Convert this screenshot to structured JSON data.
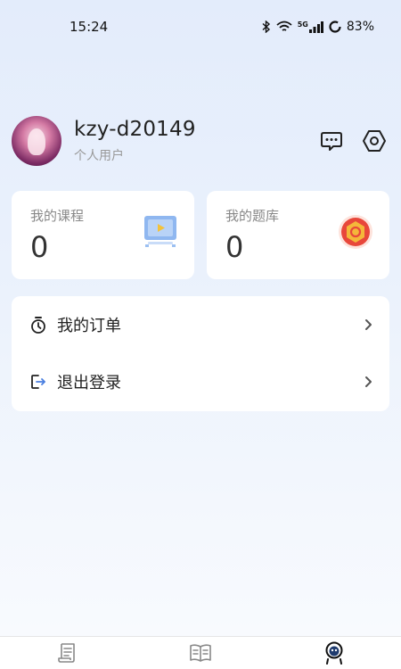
{
  "status_bar": {
    "time": "15:24",
    "network": "5G",
    "battery": "83%",
    "icons": [
      "bluetooth-icon",
      "wifi-icon",
      "signal-icon",
      "battery-icon"
    ]
  },
  "profile": {
    "username": "kzy-d20149",
    "role": "个人用户",
    "actions": [
      "message-icon",
      "settings-icon"
    ]
  },
  "stats": [
    {
      "label": "我的课程",
      "value": "0",
      "icon": "course-video-icon"
    },
    {
      "label": "我的题库",
      "value": "0",
      "icon": "question-bank-badge-icon"
    }
  ],
  "menu": [
    {
      "label": "我的订单",
      "icon": "timer-icon"
    },
    {
      "label": "退出登录",
      "icon": "logout-icon"
    }
  ],
  "bottom_nav": [
    {
      "name": "study-tab",
      "icon": "document-icon",
      "active": false
    },
    {
      "name": "library-tab",
      "icon": "book-icon",
      "active": false
    },
    {
      "name": "profile-tab",
      "icon": "profile-mascot-icon",
      "active": true
    }
  ],
  "colors": {
    "accent_blue": "#4a7fe0",
    "badge_red": "#e8473b",
    "badge_gold": "#f4b73a"
  }
}
